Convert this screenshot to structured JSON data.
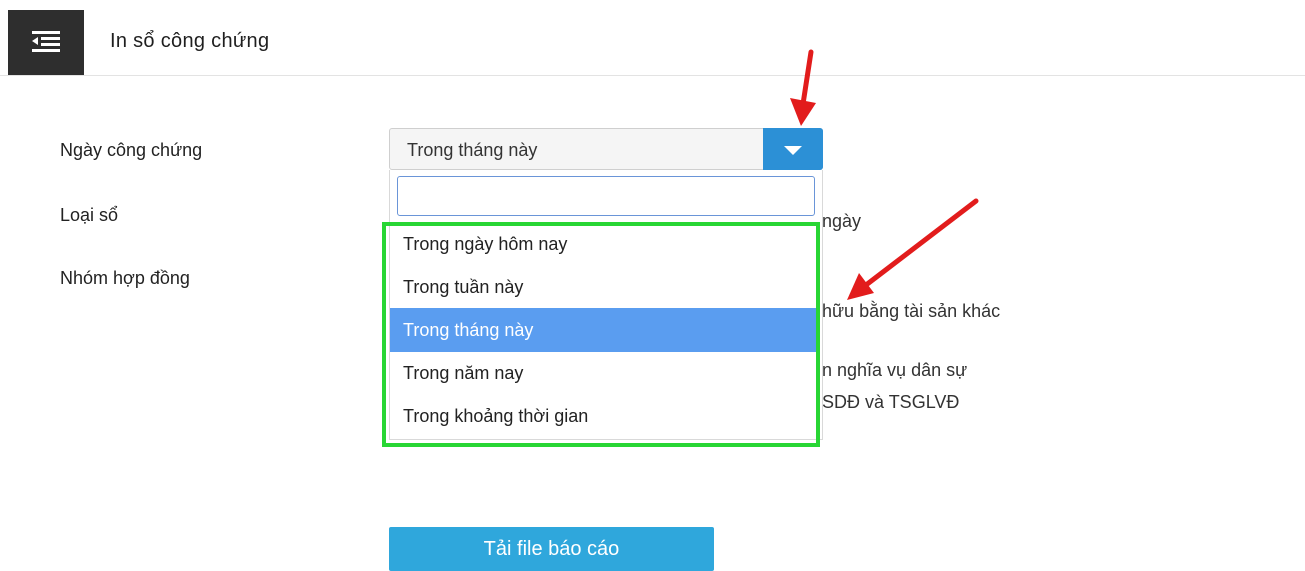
{
  "header": {
    "title": "In sổ công chứng"
  },
  "form": {
    "date_label": "Ngày công chứng",
    "book_type_label": "Loại sổ",
    "contract_group_label": "Nhóm hợp đồng",
    "date_select": {
      "value": "Trong tháng này",
      "search_value": "",
      "options": [
        "Trong ngày hôm nay",
        "Trong tuần này",
        "Trong tháng này",
        "Trong năm nay",
        "Trong khoảng thời gian"
      ],
      "selected_index": 2
    },
    "background_fragments": [
      "ngày",
      "hữu bằng tài sản khác",
      "n nghĩa vụ dân sự",
      "SDĐ và TSGLVĐ"
    ],
    "submit_label": "Tải file báo cáo"
  },
  "annotations": {
    "arrow_color": "#e21c1c",
    "highlight_color": "#28d634",
    "icons": [
      "arrow-down-annotation",
      "arrow-diagonal-annotation"
    ]
  },
  "colors": {
    "header_button_bg": "#2e2e2e",
    "select_arrow_bg": "#2c90d6",
    "selected_option_bg": "#5a9df0",
    "submit_bg": "#2fa7dc"
  }
}
